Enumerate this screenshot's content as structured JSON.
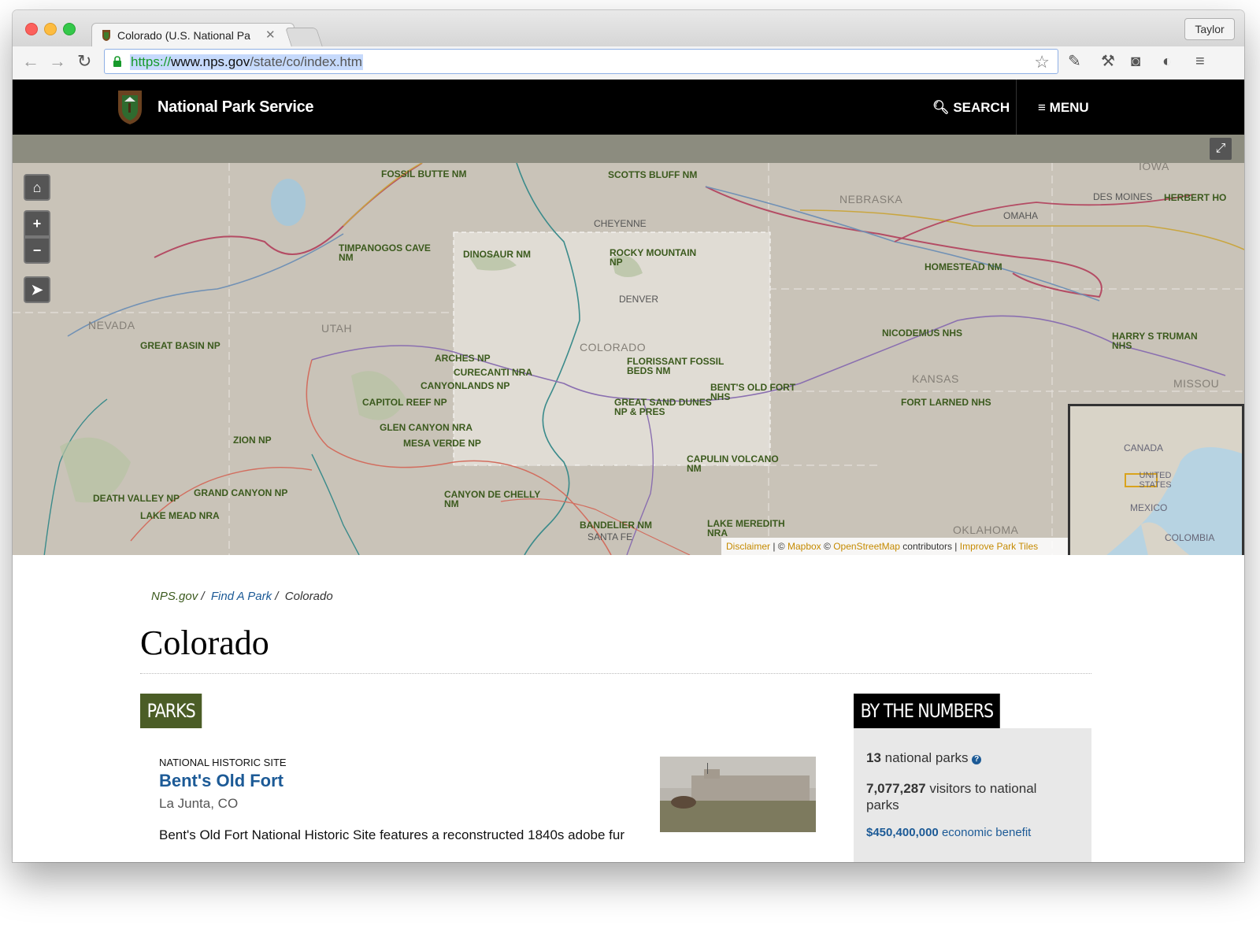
{
  "browser": {
    "tab_title": "Colorado (U.S. National Pa",
    "profile_name": "Taylor",
    "url_scheme": "https://",
    "url_host": "www.nps.gov",
    "url_path": "/state/co/index.htm"
  },
  "header": {
    "brand": "National Park Service",
    "search_label": "SEARCH",
    "menu_label": "MENU"
  },
  "map": {
    "state_labels": [
      "NEVADA",
      "UTAH",
      "COLORADO",
      "NEBRASKA",
      "KANSAS",
      "OKLAHOMA",
      "MISSOU",
      "IOWA"
    ],
    "city_labels": [
      "CHEYENNE",
      "DENVER",
      "OMAHA",
      "DES MOINES",
      "SANTA FE"
    ],
    "park_labels": [
      "FOSSIL BUTTE NM",
      "SCOTTS BLUFF NM",
      "TIMPANOGOS CAVE NM",
      "DINOSAUR NM",
      "ROCKY MOUNTAIN NP",
      "HOMESTEAD NM",
      "HERBERT HO",
      "GREAT BASIN NP",
      "ARCHES NP",
      "CURECANTI NRA",
      "CANYONLANDS NP",
      "FLORISSANT FOSSIL BEDS NM",
      "NICODEMUS NHS",
      "HARRY S TRUMAN NHS",
      "CAPITOL REEF NP",
      "BENT'S OLD FORT NHS",
      "GREAT SAND DUNES NP & PRES",
      "FORT LARNED NHS",
      "GLEN CANYON NRA",
      "MESA VERDE NP",
      "ZION NP",
      "CAPULIN VOLCANO NM",
      "DEATH VALLEY NP",
      "GRAND CANYON NP",
      "LAKE MEAD NRA",
      "CANYON DE CHELLY NM",
      "BANDELIER NM",
      "LAKE MEREDITH NRA"
    ],
    "attribution": {
      "disclaimer": "Disclaimer",
      "mapbox": "Mapbox",
      "osm": "OpenStreetMap",
      "contributors": "contributors",
      "improve": "Improve Park Tiles"
    },
    "inset_labels": [
      "CANADA",
      "UNITED STATES",
      "MEXICO",
      "COLOMBIA"
    ]
  },
  "breadcrumb": {
    "home": "NPS.gov",
    "find": "Find A Park",
    "current": "Colorado"
  },
  "page_title": "Colorado",
  "parks_heading": "PARKS",
  "park": {
    "type": "NATIONAL HISTORIC SITE",
    "name": "Bent's Old Fort",
    "location": "La Junta, CO",
    "description": "Bent's Old Fort National Historic Site features a reconstructed 1840s adobe fur"
  },
  "numbers": {
    "heading": "BY THE NUMBERS",
    "parks_count": "13",
    "parks_text": "national parks",
    "visitors_count": "7,077,287",
    "visitors_text": "visitors to national parks",
    "economic_amount": "$450,400,000",
    "economic_text": "economic benefit"
  },
  "colors": {
    "nps_header": "#000000",
    "parks_badge": "#4b5d26",
    "link_blue": "#1c5a96",
    "park_label_green": "#3b5a1d"
  }
}
